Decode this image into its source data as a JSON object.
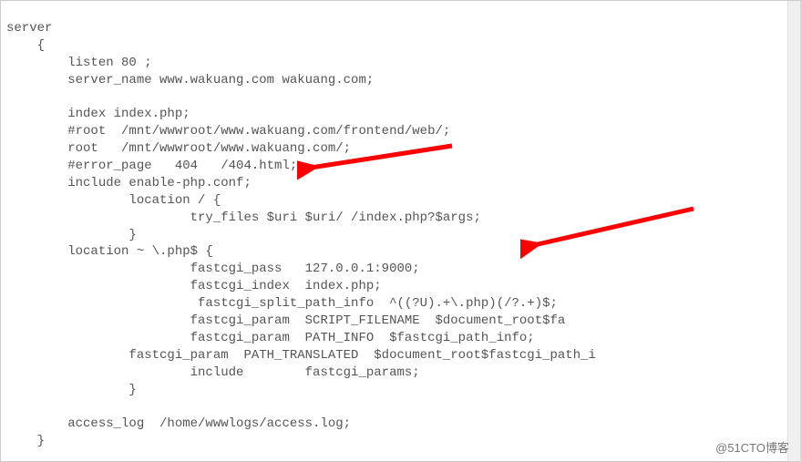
{
  "code": {
    "l0": "server",
    "l1": "    {",
    "l2": "        listen 80 ;",
    "l3": "        server_name www.wakuang.com wakuang.com;",
    "l4": "",
    "l5": "        index index.php;",
    "l6": "        #root  /mnt/wwwroot/www.wakuang.com/frontend/web/;",
    "l7": "        root   /mnt/wwwroot/www.wakuang.com/;",
    "l8": "        #error_page   404   /404.html;",
    "l9": "        include enable-php.conf;",
    "l10": "                location / {",
    "l11": "                        try_files $uri $uri/ /index.php?$args;",
    "l12": "                }",
    "l13": "        location ~ \\.php$ {",
    "l14": "                        fastcgi_pass   127.0.0.1:9000;",
    "l15": "                        fastcgi_index  index.php;",
    "l16": "                         fastcgi_split_path_info  ^((?U).+\\.php)(/?.+)$;",
    "l17": "                        fastcgi_param  SCRIPT_FILENAME  $document_root$fa",
    "l18": "                        fastcgi_param  PATH_INFO  $fastcgi_path_info;",
    "l19": "                fastcgi_param  PATH_TRANSLATED  $document_root$fastcgi_path_i",
    "l20": "                        include        fastcgi_params;",
    "l21": "                }",
    "l22": "",
    "l23": "        access_log  /home/wwwlogs/access.log;",
    "l24": "    }"
  },
  "watermark": "@51CTO博客",
  "arrows": {
    "arrow1_color": "#ff0000",
    "arrow2_color": "#ff0000"
  }
}
